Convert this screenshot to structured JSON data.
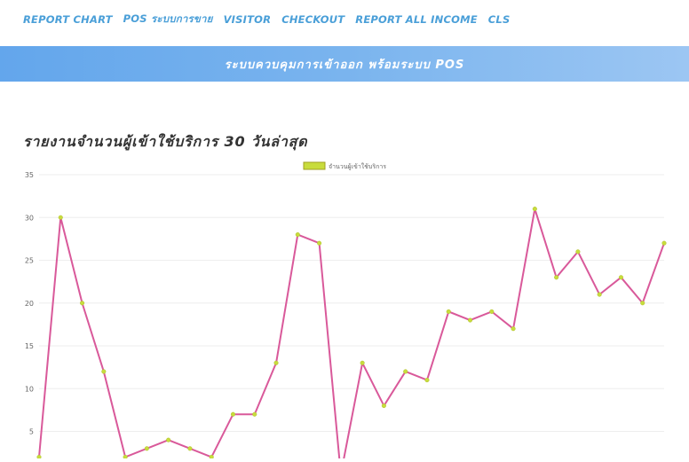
{
  "nav": {
    "items": [
      {
        "label": "REPORT CHART",
        "name": "nav-report-chart"
      },
      {
        "label": "POS ระบบการขาย",
        "name": "nav-pos"
      },
      {
        "label": "VISITOR",
        "name": "nav-visitor"
      },
      {
        "label": "CHECKOUT",
        "name": "nav-checkout"
      },
      {
        "label": "REPORT ALL INCOME",
        "name": "nav-report-all-income"
      },
      {
        "label": "CLS",
        "name": "nav-cls"
      }
    ]
  },
  "banner": {
    "title": "ระบบควบคุมการเข้าออก พร้อมระบบ POS"
  },
  "colors": {
    "nav_link": "#4a9fd8",
    "line": "#d9599a",
    "point": "#c8dc3c",
    "grid": "#eeeeee",
    "tick": "#666666"
  },
  "chart_data": {
    "type": "line",
    "title": "รายงานจำนวนผู้เข้าใช้บริการ 30 วันล่าสุด",
    "legend": "จำนวนผู้เข้าใช้บริการ",
    "legend_position": "top-center",
    "grid": true,
    "ylim": [
      0,
      35
    ],
    "yticks": [
      5,
      10,
      15,
      20,
      25,
      30,
      35
    ],
    "series": [
      {
        "name": "จำนวนผู้เข้าใช้บริการ",
        "values": [
          2,
          30,
          20,
          12,
          2,
          3,
          4,
          3,
          2,
          7,
          7,
          13,
          28,
          27,
          0,
          13,
          8,
          12,
          11,
          19,
          18,
          19,
          17,
          31,
          23,
          26,
          21,
          23,
          20,
          27
        ]
      }
    ]
  }
}
